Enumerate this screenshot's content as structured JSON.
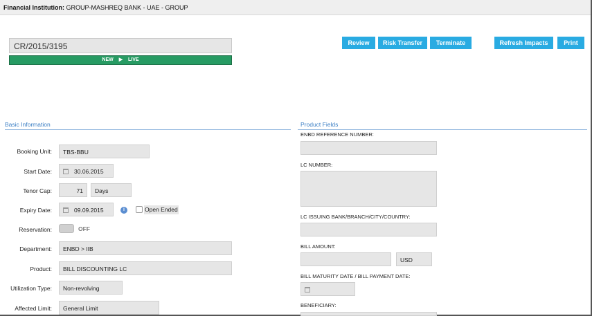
{
  "header": {
    "label": "Financial Institution:",
    "value": "GROUP-MASHREQ BANK - UAE - GROUP"
  },
  "record": {
    "reference": "CR/2015/3195",
    "status_from": "NEW",
    "status_to": "LIVE"
  },
  "toolbar": {
    "review": "Review",
    "risk_transfer": "Risk Transfer",
    "terminate": "Terminate",
    "refresh_impacts": "Refresh Impacts",
    "print": "Print"
  },
  "basic": {
    "title": "Basic Information",
    "booking_unit_label": "Booking Unit:",
    "booking_unit": "TBS-BBU",
    "start_date_label": "Start Date:",
    "start_date": "30.06.2015",
    "tenor_cap_label": "Tenor Cap:",
    "tenor_cap_value": "71",
    "tenor_cap_unit": "Days",
    "expiry_date_label": "Expiry Date:",
    "expiry_date": "09.09.2015",
    "open_ended_label": "Open Ended",
    "reservation_label": "Reservation:",
    "reservation_state": "OFF",
    "department_label": "Department:",
    "department": "ENBD > IIB",
    "product_label": "Product:",
    "product": "BILL DISCOUNTING LC",
    "utilization_type_label": "Utilization Type:",
    "utilization_type": "Non-revolving",
    "affected_limit_label": "Affected Limit:",
    "affected_limit": "General Limit"
  },
  "product_fields": {
    "title": "Product Fields",
    "enbd_ref_label": "ENBD REFERENCE NUMBER:",
    "lc_number_label": "LC NUMBER:",
    "lc_issuing_bank_label": "LC ISSUING BANK/BRANCH/CITY/COUNTRY:",
    "bill_amount_label": "BILL AMOUNT:",
    "bill_amount_currency": "USD",
    "bill_maturity_label": "BILL MATURITY DATE / BILL PAYMENT DATE:",
    "beneficiary_label": "BENEFICIARY:"
  },
  "colors": {
    "accent": "#29abe2",
    "status_green": "#279b63",
    "section_blue": "#3a7ec4"
  }
}
